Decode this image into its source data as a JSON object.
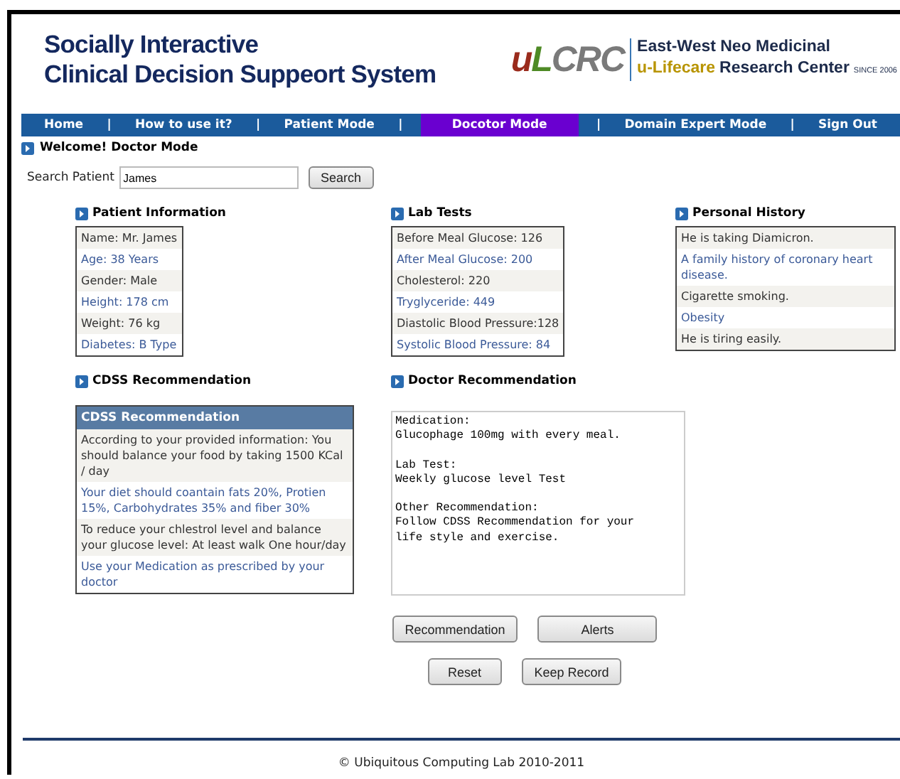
{
  "header": {
    "title_lines": [
      "Socially Interactive",
      "Clinical Decision Suppeort System"
    ],
    "logo_letters": [
      {
        "text": "u",
        "color": "#9a2b1c"
      },
      {
        "text": "L",
        "color": "#4e8a25"
      },
      {
        "text": "CRC",
        "color": "#7a7a7a"
      }
    ],
    "org_line": "East-West Neo Medicinal",
    "org_parts": [
      {
        "kind": "accent",
        "text": "u-Lifecare"
      },
      {
        "kind": "plain",
        "text": "Research Center"
      }
    ],
    "since": "SINCE 2006"
  },
  "nav": [
    {
      "kind": "link",
      "label": "Home",
      "selected": false
    },
    {
      "kind": "separator",
      "label": "|"
    },
    {
      "kind": "link",
      "label": "How to use it?",
      "selected": false
    },
    {
      "kind": "separator",
      "label": "|"
    },
    {
      "kind": "link",
      "label": "Patient Mode",
      "selected": false
    },
    {
      "kind": "separator",
      "label": "|"
    },
    {
      "kind": "link",
      "label": "Docotor Mode",
      "selected": true
    },
    {
      "kind": "separator",
      "label": "|"
    },
    {
      "kind": "link",
      "label": "Domain Expert Mode",
      "selected": false
    },
    {
      "kind": "separator",
      "label": "|"
    },
    {
      "kind": "link",
      "label": "Sign Out",
      "selected": false
    }
  ],
  "welcome": "Welcome! Doctor Mode",
  "search": {
    "label": "Search Patient",
    "value": "James",
    "button": "Search"
  },
  "sections": [
    {
      "title": "Patient Information",
      "rows": [
        "Name: Mr. James",
        "Age: 38 Years",
        "Gender: Male",
        "Height: 178 cm",
        "Weight: 76 kg",
        "Diabetes: B Type"
      ]
    },
    {
      "title": "Lab Tests",
      "rows": [
        "Before Meal Glucose: 126",
        "After Meal Glucose: 200",
        "Cholesterol: 220",
        "Tryglyceride: 449",
        "Diastolic Blood Pressure:128",
        "Systolic Blood Pressure: 84"
      ]
    },
    {
      "title": "Personal History",
      "rows": [
        "He is taking Diamicron.",
        "A family history of coronary heart disease.",
        "Cigarette smoking.",
        "Obesity",
        "He is tiring easily."
      ]
    }
  ],
  "cdss": {
    "title": "CDSS Recommendation",
    "table_header": "CDSS Recommendation",
    "rows": [
      "According to your provided information: You should balance your food by taking 1500 KCal / day",
      "Your diet should coantain fats 20%, Protien 15%, Carbohydrates 35% and fiber 30%",
      "To reduce your chlestrol level and balance your glucose level: At least walk One hour/day",
      "Use your Medication as prescribed by your doctor"
    ]
  },
  "doctor": {
    "title": "Doctor Recommendation",
    "value": "Medication:\nGlucophage 100mg with every meal.\n\nLab Test:\nWeekly glucose level Test\n\nOther Recommendation:\nFollow CDSS Recommendation for your\nlife style and exercise."
  },
  "button_rows": [
    [
      "Recommendation",
      "Alerts"
    ],
    [
      "Reset",
      "Keep Record"
    ]
  ],
  "footer": "© Ubiquitous Computing Lab 2010-2011"
}
